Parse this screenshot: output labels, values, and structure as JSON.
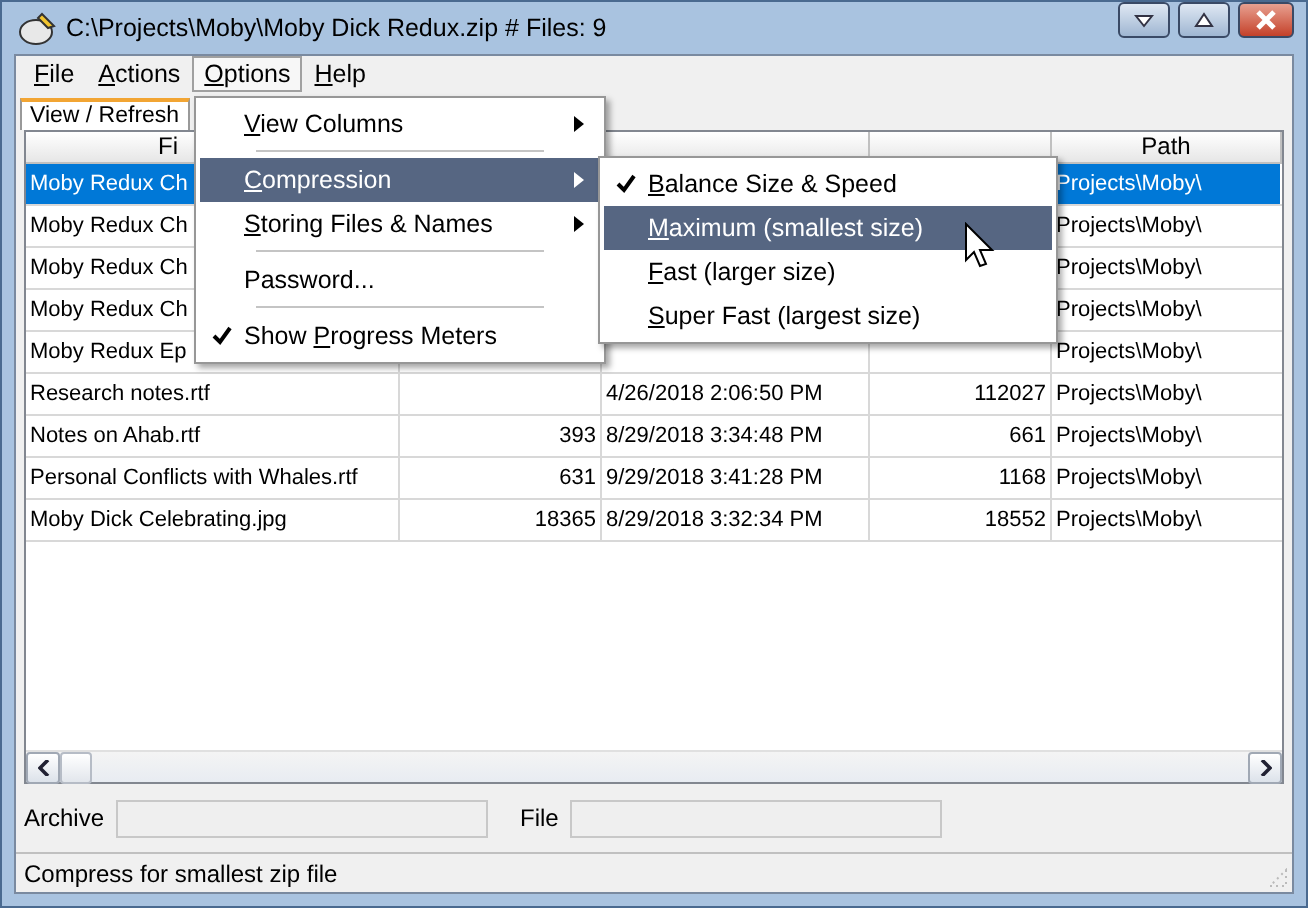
{
  "window": {
    "title": "C:\\Projects\\Moby\\Moby Dick Redux.zip  # Files: 9"
  },
  "menu_bar": [
    {
      "label": {
        "key": "F",
        "post": "ile"
      },
      "open": false
    },
    {
      "label": {
        "key": "A",
        "post": "ctions"
      },
      "open": false
    },
    {
      "label": {
        "key": "O",
        "post": "ptions"
      },
      "open": true
    },
    {
      "label": {
        "key": "H",
        "post": "elp"
      },
      "open": false
    }
  ],
  "tabs": [
    {
      "label": "View / Refresh",
      "selected": true
    }
  ],
  "table": {
    "columns": [
      "Fi",
      "",
      "",
      "",
      "Path"
    ],
    "rows": [
      {
        "selected": true,
        "cells": [
          "Moby Redux Ch",
          "",
          "",
          "",
          "Projects\\Moby\\"
        ]
      },
      {
        "selected": false,
        "cells": [
          "Moby Redux Ch",
          "",
          "",
          "",
          "Projects\\Moby\\"
        ]
      },
      {
        "selected": false,
        "cells": [
          "Moby Redux Ch",
          "",
          "",
          "",
          "Projects\\Moby\\"
        ]
      },
      {
        "selected": false,
        "cells": [
          "Moby Redux Ch",
          "",
          "",
          "",
          "Projects\\Moby\\"
        ]
      },
      {
        "selected": false,
        "cells": [
          "Moby Redux Ep",
          "",
          "",
          "",
          "Projects\\Moby\\"
        ]
      },
      {
        "selected": false,
        "cells": [
          "Research notes.rtf",
          "",
          "4/26/2018 2:06:50 PM",
          "112027",
          "Projects\\Moby\\"
        ]
      },
      {
        "selected": false,
        "cells": [
          "Notes on Ahab.rtf",
          "393",
          "8/29/2018 3:34:48 PM",
          "661",
          "Projects\\Moby\\"
        ]
      },
      {
        "selected": false,
        "cells": [
          "Personal Conflicts with Whales.rtf",
          "631",
          "9/29/2018 3:41:28 PM",
          "1168",
          "Projects\\Moby\\"
        ]
      },
      {
        "selected": false,
        "cells": [
          "Moby Dick Celebrating.jpg",
          "18365",
          "8/29/2018 3:32:34 PM",
          "18552",
          "Projects\\Moby\\"
        ]
      }
    ]
  },
  "options_menu": [
    {
      "kind": "item",
      "label": {
        "key": "V",
        "post": "iew Columns"
      },
      "submenu": true,
      "checked": false,
      "selected": false
    },
    {
      "kind": "separator"
    },
    {
      "kind": "item",
      "label": {
        "key": "C",
        "post": "ompression"
      },
      "submenu": true,
      "checked": false,
      "selected": true
    },
    {
      "kind": "item",
      "label": {
        "key": "S",
        "post": "toring Files & Names"
      },
      "submenu": true,
      "checked": false,
      "selected": false
    },
    {
      "kind": "separator"
    },
    {
      "kind": "item",
      "label": {
        "pre": "Password..."
      },
      "submenu": false,
      "checked": false,
      "selected": false
    },
    {
      "kind": "separator"
    },
    {
      "kind": "item",
      "label": {
        "pre": "Show ",
        "key": "P",
        "post": "rogress Meters"
      },
      "submenu": false,
      "checked": true,
      "selected": false
    }
  ],
  "compression_menu": [
    {
      "label": {
        "key": "B",
        "post": "alance Size & Speed"
      },
      "checked": true,
      "selected": false
    },
    {
      "label": {
        "key": "M",
        "post": "aximum (smallest size)"
      },
      "checked": false,
      "selected": true
    },
    {
      "label": {
        "key": "F",
        "post": "ast (larger size)"
      },
      "checked": false,
      "selected": false
    },
    {
      "label": {
        "key": "S",
        "post": "uper Fast (largest size)"
      },
      "checked": false,
      "selected": false
    }
  ],
  "progress": {
    "archive_label": "Archive",
    "file_label": "File"
  },
  "status_bar": {
    "text": "Compress for smallest zip file"
  }
}
